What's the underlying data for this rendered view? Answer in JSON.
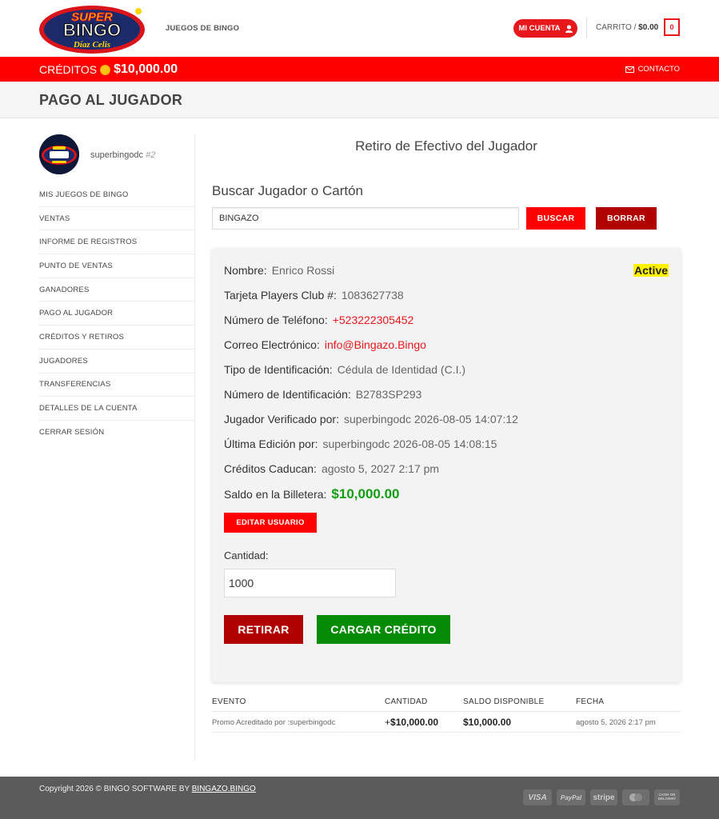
{
  "header": {
    "logo_text": [
      "SUPER",
      "BINGO",
      "Díaz Celis"
    ],
    "nav_link": "JUEGOS DE BINGO",
    "account_button": "MI CUENTA",
    "cart_label": "CARRITO /",
    "cart_total": "$0.00",
    "cart_count": "0"
  },
  "redbar": {
    "credits_label": "CRÉDITOS",
    "credits_amount": "$10,000.00",
    "contact_link": "CONTACTO"
  },
  "page_title": "PAGO AL JUGADOR",
  "sidebar": {
    "username": "superbingodc",
    "user_number": "#2",
    "items": [
      "MIS JUEGOS DE BINGO",
      "VENTAS",
      "INFORME DE REGISTROS",
      "PUNTO DE VENTAS",
      "GANADORES",
      "PAGO AL JUGADOR",
      "CRÉDITOS Y RETIROS",
      "JUGADORES",
      "TRANSFERENCIAS",
      "DETALLES DE LA CUENTA",
      "CERRAR SESIÓN"
    ]
  },
  "main": {
    "title": "Retiro de Efectivo del Jugador",
    "search_heading": "Buscar Jugador o Cartón",
    "search_value": "BINGAZO",
    "search_button": "BUSCAR",
    "clear_button": "BORRAR"
  },
  "player": {
    "status": "Active",
    "fields": [
      {
        "label": "Nombre:",
        "value": "Enrico Rossi"
      },
      {
        "label": "Tarjeta Players Club #:",
        "value": "1083627738"
      },
      {
        "label": "Número de Teléfono:",
        "value": "+523222305452"
      },
      {
        "label": "Correo Electrónico:",
        "value": "info@Bingazo.Bingo"
      },
      {
        "label": "Tipo de Identificación:",
        "value": "Cédula de Identidad (C.I.)"
      },
      {
        "label": "Número de Identificación:",
        "value": "B2783SP293"
      },
      {
        "label": "Jugador Verificado por:",
        "value": "superbingodc 2026-08-05 14:07:12"
      },
      {
        "label": "Última Edición por:",
        "value": "superbingodc 2026-08-05 14:08:15"
      },
      {
        "label": "Créditos Caducan:",
        "value": "agosto 5, 2027 2:17 pm"
      },
      {
        "label": "Saldo en la Billetera:",
        "value": "$10,000.00"
      }
    ],
    "edit_button": "EDITAR USUARIO",
    "amount_label": "Cantidad:",
    "amount_value": "1000",
    "withdraw_button": "RETIRAR",
    "load_button": "CARGAR CRÉDITO"
  },
  "transactions": {
    "headers": [
      "EVENTO",
      "CANTIDAD",
      "SALDO DISPONIBLE",
      "FECHA"
    ],
    "rows": [
      {
        "evento": "Promo Acreditado por :superbingodc",
        "cantidad_sign": "+",
        "cantidad": "$10,000.00",
        "saldo": "$10,000.00",
        "fecha": "agosto 5, 2026 2:17 pm"
      }
    ]
  },
  "footer": {
    "copyright": "Copyright 2026 © BINGO SOFTWARE BY",
    "copyright_link": "BINGAZO.BINGO",
    "payments": [
      "VISA",
      "PayPal",
      "stripe",
      "mastercard",
      "CASH ON DELIVERY"
    ]
  },
  "colors": {
    "brand_red": "#fe0000",
    "dark_red": "#b00000",
    "green": "#058b05",
    "status_highlight": "#fff200"
  }
}
